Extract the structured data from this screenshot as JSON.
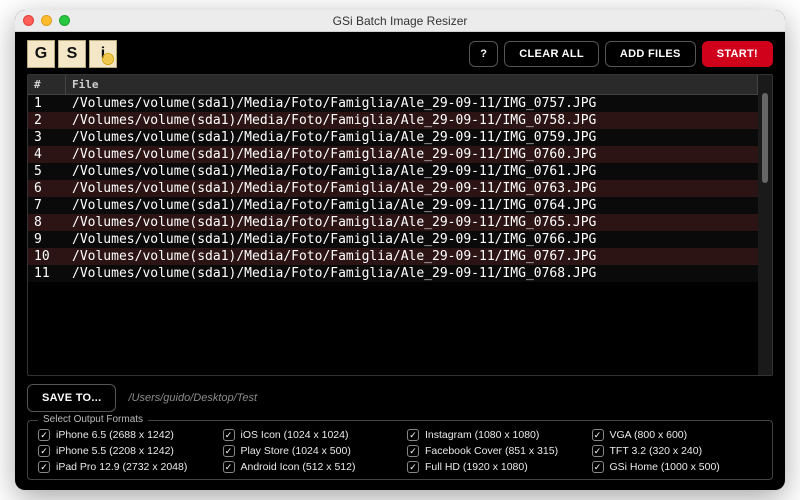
{
  "window": {
    "title": "GSi Batch Image Resizer"
  },
  "logo": {
    "letters": [
      "G",
      "S",
      "i"
    ]
  },
  "toolbar": {
    "help_label": "?",
    "clear_all_label": "CLEAR ALL",
    "add_files_label": "ADD FILES",
    "start_label": "START!"
  },
  "table": {
    "headers": {
      "index": "#",
      "file": "File"
    },
    "rows": [
      {
        "index": "1",
        "file": "/Volumes/volume(sda1)/Media/Foto/Famiglia/Ale_29-09-11/IMG_0757.JPG"
      },
      {
        "index": "2",
        "file": "/Volumes/volume(sda1)/Media/Foto/Famiglia/Ale_29-09-11/IMG_0758.JPG"
      },
      {
        "index": "3",
        "file": "/Volumes/volume(sda1)/Media/Foto/Famiglia/Ale_29-09-11/IMG_0759.JPG"
      },
      {
        "index": "4",
        "file": "/Volumes/volume(sda1)/Media/Foto/Famiglia/Ale_29-09-11/IMG_0760.JPG"
      },
      {
        "index": "5",
        "file": "/Volumes/volume(sda1)/Media/Foto/Famiglia/Ale_29-09-11/IMG_0761.JPG"
      },
      {
        "index": "6",
        "file": "/Volumes/volume(sda1)/Media/Foto/Famiglia/Ale_29-09-11/IMG_0763.JPG"
      },
      {
        "index": "7",
        "file": "/Volumes/volume(sda1)/Media/Foto/Famiglia/Ale_29-09-11/IMG_0764.JPG"
      },
      {
        "index": "8",
        "file": "/Volumes/volume(sda1)/Media/Foto/Famiglia/Ale_29-09-11/IMG_0765.JPG"
      },
      {
        "index": "9",
        "file": "/Volumes/volume(sda1)/Media/Foto/Famiglia/Ale_29-09-11/IMG_0766.JPG"
      },
      {
        "index": "10",
        "file": "/Volumes/volume(sda1)/Media/Foto/Famiglia/Ale_29-09-11/IMG_0767.JPG"
      },
      {
        "index": "11",
        "file": "/Volumes/volume(sda1)/Media/Foto/Famiglia/Ale_29-09-11/IMG_0768.JPG"
      }
    ]
  },
  "save": {
    "button_label": "SAVE TO...",
    "path": "/Users/guido/Desktop/Test"
  },
  "formats": {
    "legend": "Select Output Formats",
    "items": [
      {
        "label": "iPhone 6.5 (2688 x 1242)"
      },
      {
        "label": "iOS Icon (1024 x 1024)"
      },
      {
        "label": "Instagram (1080 x 1080)"
      },
      {
        "label": "VGA (800 x 600)"
      },
      {
        "label": "iPhone 5.5 (2208 x 1242)"
      },
      {
        "label": "Play Store (1024 x 500)"
      },
      {
        "label": "Facebook Cover (851 x 315)"
      },
      {
        "label": "TFT 3.2 (320 x 240)"
      },
      {
        "label": "iPad Pro 12.9 (2732 x 2048)"
      },
      {
        "label": "Android Icon (512 x 512)"
      },
      {
        "label": "Full HD (1920 x 1080)"
      },
      {
        "label": "GSi Home (1000 x 500)"
      }
    ]
  }
}
